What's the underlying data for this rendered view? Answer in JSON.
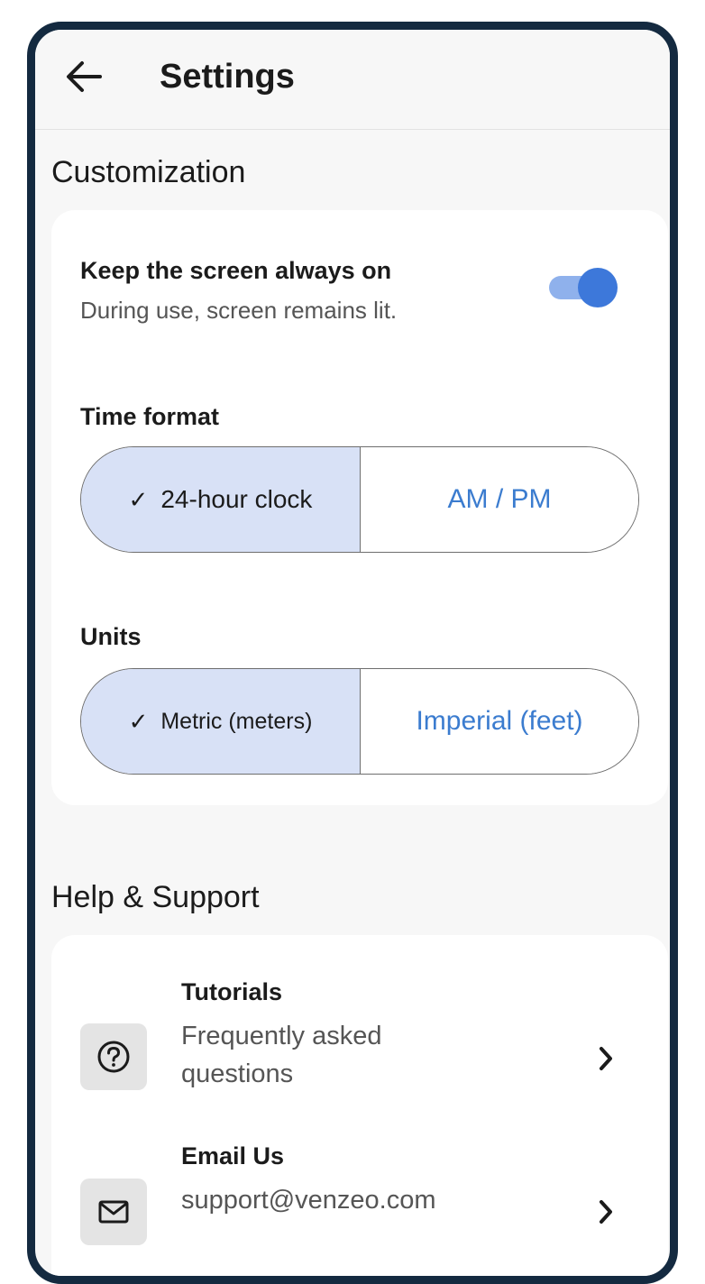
{
  "header": {
    "title": "Settings",
    "back_icon": "arrow-left-icon"
  },
  "customization": {
    "section_title": "Customization",
    "screen_on": {
      "title": "Keep the screen always on",
      "subtitle": "During use, screen remains lit.",
      "enabled": true
    },
    "time_format": {
      "label": "Time format",
      "options": [
        "24-hour clock",
        "AM / PM"
      ],
      "selected": "24-hour clock"
    },
    "units": {
      "label": "Units",
      "options": [
        "Metric (meters)",
        "Imperial (feet)"
      ],
      "selected": "Metric (meters)"
    }
  },
  "help": {
    "section_title": "Help & Support",
    "items": [
      {
        "title": "Tutorials",
        "subtitle_line1": "Frequently asked",
        "subtitle_line2": "questions",
        "icon": "question-circle-icon"
      },
      {
        "title": "Email Us",
        "subtitle": "support@venzeo.com",
        "icon": "mail-icon"
      }
    ]
  },
  "colors": {
    "frame": "#142a40",
    "accent": "#3d78da",
    "selected_segment": "#d8e1f6",
    "link_text": "#3b7ccf"
  }
}
